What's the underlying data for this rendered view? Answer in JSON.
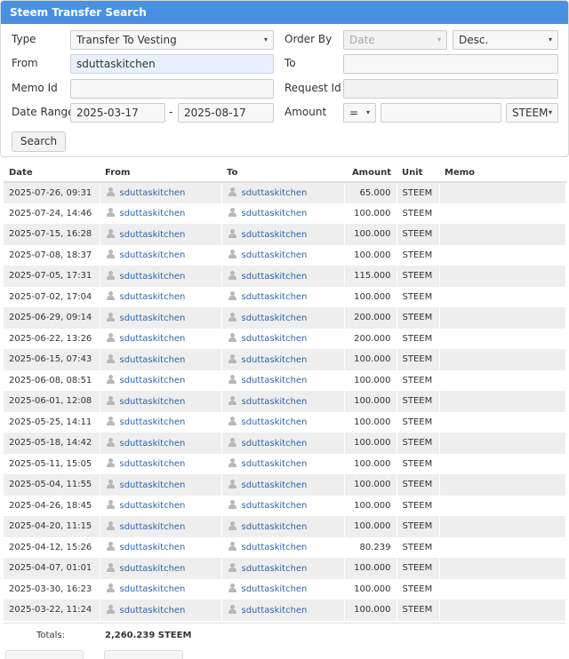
{
  "panel": {
    "title": "Steem Transfer Search",
    "type_label": "Type",
    "type_value": "Transfer To Vesting",
    "order_label": "Order By",
    "order_field_value": "Date",
    "order_dir_value": "Desc.",
    "from_label": "From",
    "from_value": "sduttaskitchen",
    "to_label": "To",
    "to_value": "",
    "memo_id_label": "Memo Id",
    "memo_id_value": "",
    "request_id_label": "Request Id",
    "request_id_value": "",
    "date_range_label": "Date Range",
    "date_from": "2025-03-17",
    "date_separator": "-",
    "date_to": "2025-08-17",
    "amount_label": "Amount",
    "amount_op": "=",
    "amount_value": "",
    "amount_currency": "STEEM",
    "search_label": "Search"
  },
  "table": {
    "headers": {
      "date": "Date",
      "from": "From",
      "to": "To",
      "amount": "Amount",
      "unit": "Unit",
      "memo": "Memo"
    },
    "rows": [
      {
        "date": "2025-07-26, 09:31",
        "from": "sduttaskitchen",
        "to": "sduttaskitchen",
        "amount": "65.000",
        "unit": "STEEM",
        "memo": ""
      },
      {
        "date": "2025-07-24, 14:46",
        "from": "sduttaskitchen",
        "to": "sduttaskitchen",
        "amount": "100.000",
        "unit": "STEEM",
        "memo": ""
      },
      {
        "date": "2025-07-15, 16:28",
        "from": "sduttaskitchen",
        "to": "sduttaskitchen",
        "amount": "100.000",
        "unit": "STEEM",
        "memo": ""
      },
      {
        "date": "2025-07-08, 18:37",
        "from": "sduttaskitchen",
        "to": "sduttaskitchen",
        "amount": "100.000",
        "unit": "STEEM",
        "memo": ""
      },
      {
        "date": "2025-07-05, 17:31",
        "from": "sduttaskitchen",
        "to": "sduttaskitchen",
        "amount": "115.000",
        "unit": "STEEM",
        "memo": ""
      },
      {
        "date": "2025-07-02, 17:04",
        "from": "sduttaskitchen",
        "to": "sduttaskitchen",
        "amount": "100.000",
        "unit": "STEEM",
        "memo": ""
      },
      {
        "date": "2025-06-29, 09:14",
        "from": "sduttaskitchen",
        "to": "sduttaskitchen",
        "amount": "200.000",
        "unit": "STEEM",
        "memo": ""
      },
      {
        "date": "2025-06-22, 13:26",
        "from": "sduttaskitchen",
        "to": "sduttaskitchen",
        "amount": "200.000",
        "unit": "STEEM",
        "memo": ""
      },
      {
        "date": "2025-06-15, 07:43",
        "from": "sduttaskitchen",
        "to": "sduttaskitchen",
        "amount": "100.000",
        "unit": "STEEM",
        "memo": ""
      },
      {
        "date": "2025-06-08, 08:51",
        "from": "sduttaskitchen",
        "to": "sduttaskitchen",
        "amount": "100.000",
        "unit": "STEEM",
        "memo": ""
      },
      {
        "date": "2025-06-01, 12:08",
        "from": "sduttaskitchen",
        "to": "sduttaskitchen",
        "amount": "100.000",
        "unit": "STEEM",
        "memo": ""
      },
      {
        "date": "2025-05-25, 14:11",
        "from": "sduttaskitchen",
        "to": "sduttaskitchen",
        "amount": "100.000",
        "unit": "STEEM",
        "memo": ""
      },
      {
        "date": "2025-05-18, 14:42",
        "from": "sduttaskitchen",
        "to": "sduttaskitchen",
        "amount": "100.000",
        "unit": "STEEM",
        "memo": ""
      },
      {
        "date": "2025-05-11, 15:05",
        "from": "sduttaskitchen",
        "to": "sduttaskitchen",
        "amount": "100.000",
        "unit": "STEEM",
        "memo": ""
      },
      {
        "date": "2025-05-04, 11:55",
        "from": "sduttaskitchen",
        "to": "sduttaskitchen",
        "amount": "100.000",
        "unit": "STEEM",
        "memo": ""
      },
      {
        "date": "2025-04-26, 18:45",
        "from": "sduttaskitchen",
        "to": "sduttaskitchen",
        "amount": "100.000",
        "unit": "STEEM",
        "memo": ""
      },
      {
        "date": "2025-04-20, 11:15",
        "from": "sduttaskitchen",
        "to": "sduttaskitchen",
        "amount": "100.000",
        "unit": "STEEM",
        "memo": ""
      },
      {
        "date": "2025-04-12, 15:26",
        "from": "sduttaskitchen",
        "to": "sduttaskitchen",
        "amount": "80.239",
        "unit": "STEEM",
        "memo": ""
      },
      {
        "date": "2025-04-07, 01:01",
        "from": "sduttaskitchen",
        "to": "sduttaskitchen",
        "amount": "100.000",
        "unit": "STEEM",
        "memo": ""
      },
      {
        "date": "2025-03-30, 16:23",
        "from": "sduttaskitchen",
        "to": "sduttaskitchen",
        "amount": "100.000",
        "unit": "STEEM",
        "memo": ""
      },
      {
        "date": "2025-03-22, 11:24",
        "from": "sduttaskitchen",
        "to": "sduttaskitchen",
        "amount": "100.000",
        "unit": "STEEM",
        "memo": ""
      }
    ]
  },
  "totals": {
    "label": "Totals:",
    "value": "2,260.239 STEEM"
  },
  "icons": {
    "account": "user-icon",
    "dropdown": "caret-down-icon"
  },
  "colors": {
    "header": "#4a90e2",
    "link": "#2a66b0",
    "row_alt": "#eeeeee"
  }
}
